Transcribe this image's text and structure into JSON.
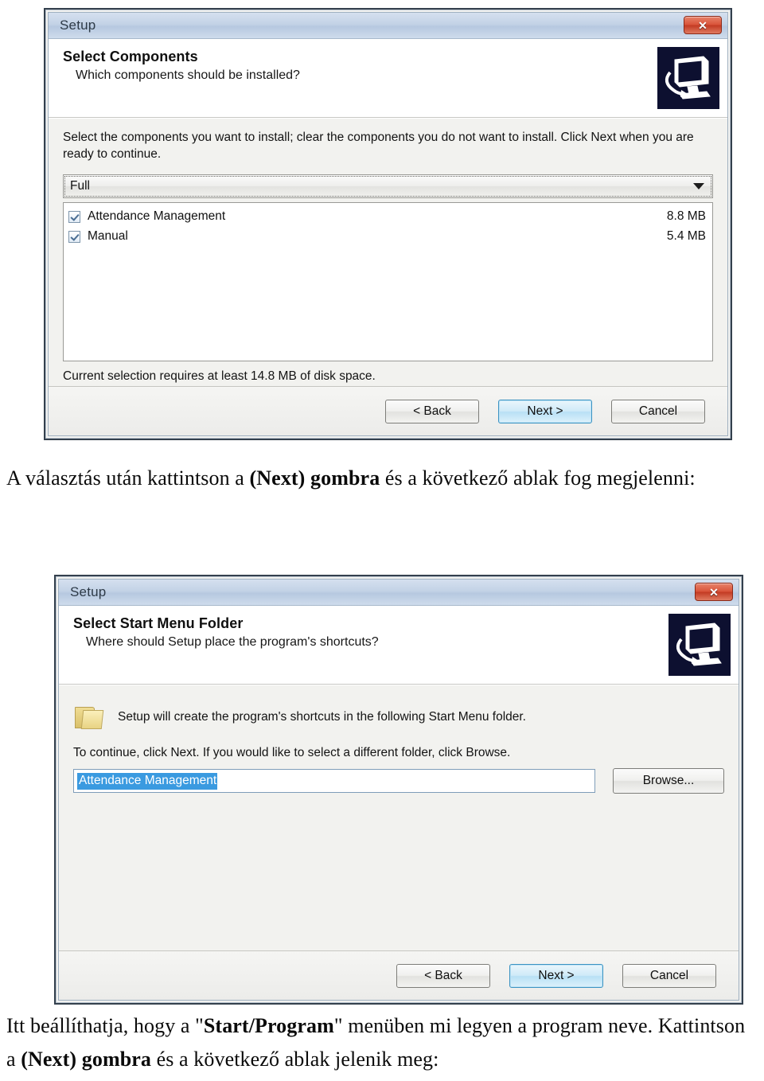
{
  "dialog1": {
    "window_title": "Setup",
    "close_label": "✕",
    "close_icon_name": "close-icon",
    "header_title": "Select Components",
    "header_subtitle": "Which components should be installed?",
    "instruction": "Select the components you want to install; clear the components you do not want to install. Click Next when you are ready to continue.",
    "combo_value": "Full",
    "components": [
      {
        "name": "Attendance Management",
        "size": "8.8 MB",
        "checked": true
      },
      {
        "name": "Manual",
        "size": "5.4 MB",
        "checked": true
      }
    ],
    "disk_space": "Current selection requires at least 14.8 MB of disk space.",
    "buttons": {
      "back": "< Back",
      "back_accel": "B",
      "next": "Next >",
      "next_accel": "N",
      "cancel": "Cancel"
    }
  },
  "paragraph1": {
    "part1": "A választás után kattintson a ",
    "bold1": "(Next) gombra",
    "part2": " és a következő ablak fog megjelenni:"
  },
  "dialog2": {
    "window_title": "Setup",
    "close_label": "✕",
    "close_icon_name": "close-icon",
    "header_title": "Select Start Menu Folder",
    "header_subtitle": "Where should Setup place the program's shortcuts?",
    "folder_message": "Setup will create the program's shortcuts in the following Start Menu folder.",
    "continue_message": "To continue, click Next. If you would like to select a different folder, click Browse.",
    "folder_value": "Attendance Management",
    "browse_label": "Browse...",
    "buttons": {
      "back": "< Back",
      "back_accel": "B",
      "next": "Next >",
      "next_accel": "N",
      "cancel": "Cancel"
    }
  },
  "paragraph2": {
    "part1": "Itt beállíthatja, hogy a \"",
    "bold1": "Start/Program",
    "part2": "\" menüben mi legyen a program neve. Kattintson a ",
    "bold2": "(Next) gombra",
    "part3": " és a következő ablak jelenik meg:"
  },
  "colors": {
    "titlebar": "#c3d2e6",
    "close_button": "#d9543a",
    "focus_button": "#b8e0f5",
    "selection": "#3a9ae0",
    "icon_panel": "#0d1030",
    "folder": "#e8d383"
  }
}
